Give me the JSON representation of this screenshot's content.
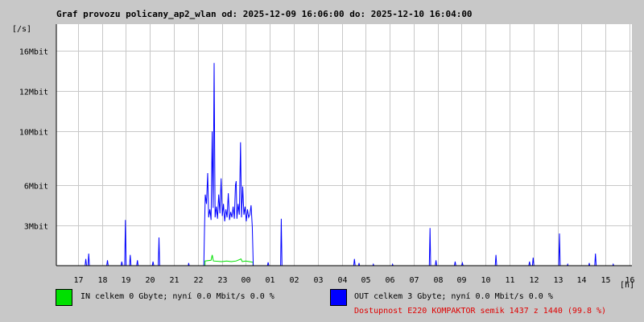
{
  "chart_data": {
    "type": "line",
    "title": "Graf provozu policany_ap2_wlan od: 2025-12-09 16:06:00 do: 2025-12-10 16:04:00",
    "ylabel": "[/s]",
    "xlabel": "[h]",
    "x_tick_labels": [
      "17",
      "18",
      "19",
      "20",
      "21",
      "22",
      "23",
      "00",
      "01",
      "02",
      "03",
      "04",
      "05",
      "06",
      "07",
      "08",
      "09",
      "10",
      "11",
      "12",
      "13",
      "14",
      "15",
      "16"
    ],
    "y_ticks": [
      {
        "value": 3,
        "label": "3Mbit"
      },
      {
        "value": 6,
        "label": "6Mbit"
      },
      {
        "value": 10,
        "label": "10Mbit"
      },
      {
        "value": 13,
        "label": "12Mbit"
      },
      {
        "value": 16,
        "label": "16Mbit"
      }
    ],
    "xlim": [
      16.1,
      40.1
    ],
    "ylim": [
      0,
      18
    ],
    "grid": true,
    "series": [
      {
        "name": "IN",
        "color": "#00e000",
        "points": [
          [
            22.3,
            0
          ],
          [
            22.3,
            0.35
          ],
          [
            22.55,
            0.4
          ],
          [
            22.6,
            0.8
          ],
          [
            22.65,
            0.35
          ],
          [
            23.0,
            0.3
          ],
          [
            23.2,
            0.35
          ],
          [
            23.4,
            0.3
          ],
          [
            23.6,
            0.35
          ],
          [
            23.8,
            0.5
          ],
          [
            23.85,
            0.3
          ],
          [
            24.0,
            0.35
          ],
          [
            24.15,
            0.3
          ],
          [
            24.3,
            0.25
          ],
          [
            24.3,
            0
          ]
        ]
      },
      {
        "name": "OUT",
        "color": "#0000ff",
        "points": [
          [
            16.1,
            0
          ],
          [
            17.3,
            0
          ],
          [
            17.33,
            0.5
          ],
          [
            17.36,
            0
          ],
          [
            17.42,
            0
          ],
          [
            17.45,
            0.9
          ],
          [
            17.48,
            0
          ],
          [
            18.2,
            0
          ],
          [
            18.23,
            0.4
          ],
          [
            18.26,
            0
          ],
          [
            18.8,
            0
          ],
          [
            18.83,
            0.3
          ],
          [
            18.86,
            0
          ],
          [
            18.95,
            0
          ],
          [
            18.98,
            3.4
          ],
          [
            19.01,
            0
          ],
          [
            19.15,
            0
          ],
          [
            19.18,
            0.8
          ],
          [
            19.21,
            0
          ],
          [
            19.45,
            0
          ],
          [
            19.48,
            0.4
          ],
          [
            19.51,
            0
          ],
          [
            20.1,
            0
          ],
          [
            20.13,
            0.3
          ],
          [
            20.16,
            0
          ],
          [
            20.35,
            0
          ],
          [
            20.38,
            2.1
          ],
          [
            20.41,
            0
          ],
          [
            21.6,
            0
          ],
          [
            21.62,
            0.2
          ],
          [
            21.64,
            0
          ],
          [
            22.25,
            0
          ],
          [
            22.28,
            2.9
          ],
          [
            22.31,
            5.3
          ],
          [
            22.36,
            4.6
          ],
          [
            22.41,
            6.9
          ],
          [
            22.45,
            3.6
          ],
          [
            22.5,
            4.2
          ],
          [
            22.55,
            3.4
          ],
          [
            22.6,
            10.0
          ],
          [
            22.64,
            4.3
          ],
          [
            22.68,
            15.1
          ],
          [
            22.72,
            3.6
          ],
          [
            22.77,
            4.4
          ],
          [
            22.82,
            3.5
          ],
          [
            22.87,
            5.3
          ],
          [
            22.92,
            3.9
          ],
          [
            22.97,
            6.5
          ],
          [
            23.02,
            3.7
          ],
          [
            23.07,
            4.6
          ],
          [
            23.12,
            3.3
          ],
          [
            23.17,
            4.2
          ],
          [
            23.22,
            3.6
          ],
          [
            23.27,
            5.4
          ],
          [
            23.32,
            3.4
          ],
          [
            23.37,
            4.0
          ],
          [
            23.42,
            3.6
          ],
          [
            23.47,
            4.4
          ],
          [
            23.52,
            3.5
          ],
          [
            23.57,
            6.0
          ],
          [
            23.6,
            6.3
          ],
          [
            23.63,
            3.5
          ],
          [
            23.68,
            4.6
          ],
          [
            23.73,
            3.8
          ],
          [
            23.78,
            9.2
          ],
          [
            23.82,
            3.6
          ],
          [
            23.87,
            5.9
          ],
          [
            23.92,
            3.8
          ],
          [
            23.97,
            4.4
          ],
          [
            24.02,
            3.3
          ],
          [
            24.07,
            4.2
          ],
          [
            24.12,
            3.6
          ],
          [
            24.17,
            3.8
          ],
          [
            24.22,
            4.5
          ],
          [
            24.27,
            2.9
          ],
          [
            24.31,
            0
          ],
          [
            24.9,
            0
          ],
          [
            24.93,
            0.25
          ],
          [
            24.96,
            0
          ],
          [
            25.45,
            0
          ],
          [
            25.48,
            3.5
          ],
          [
            25.51,
            0
          ],
          [
            28.5,
            0
          ],
          [
            28.53,
            0.5
          ],
          [
            28.56,
            0
          ],
          [
            28.7,
            0
          ],
          [
            28.72,
            0.2
          ],
          [
            28.74,
            0
          ],
          [
            29.3,
            0
          ],
          [
            29.32,
            0.1
          ],
          [
            29.34,
            0
          ],
          [
            30.1,
            0
          ],
          [
            30.12,
            0.1
          ],
          [
            30.14,
            0
          ],
          [
            31.65,
            0
          ],
          [
            31.68,
            2.8
          ],
          [
            31.71,
            0
          ],
          [
            31.9,
            0
          ],
          [
            31.93,
            0.4
          ],
          [
            31.96,
            0
          ],
          [
            32.7,
            0
          ],
          [
            32.73,
            0.3
          ],
          [
            32.76,
            0
          ],
          [
            33.0,
            0
          ],
          [
            33.03,
            0.2
          ],
          [
            33.06,
            0
          ],
          [
            34.4,
            0
          ],
          [
            34.43,
            0.8
          ],
          [
            34.46,
            0
          ],
          [
            35.8,
            0
          ],
          [
            35.83,
            0.3
          ],
          [
            35.86,
            0
          ],
          [
            35.95,
            0
          ],
          [
            35.98,
            0.6
          ],
          [
            36.01,
            0
          ],
          [
            37.05,
            0
          ],
          [
            37.08,
            2.4
          ],
          [
            37.11,
            0
          ],
          [
            37.4,
            0
          ],
          [
            37.42,
            0.1
          ],
          [
            37.44,
            0
          ],
          [
            38.3,
            0
          ],
          [
            38.32,
            0.2
          ],
          [
            38.34,
            0
          ],
          [
            38.55,
            0
          ],
          [
            38.58,
            0.9
          ],
          [
            38.61,
            0
          ],
          [
            39.3,
            0
          ],
          [
            39.32,
            0.1
          ],
          [
            39.34,
            0
          ],
          [
            40.1,
            0
          ]
        ]
      }
    ]
  },
  "legend": {
    "in_text": "IN celkem 0 Gbyte; nyní   0.0 Mbit/s 0.0 %",
    "out_text": "OUT celkem 3 Gbyte; nyní   0.0 Mbit/s 0.0 %",
    "in_color": "#00e000",
    "out_color": "#0000ff"
  },
  "availability": "Dostupnost E220 KOMPAKTOR semik 1437 z 1440 (99.8 %)",
  "colors": {
    "background": "#c8c8c8",
    "plot_bg": "#ffffff",
    "grid": "#c8c8c8",
    "availability_text": "#e00000"
  }
}
